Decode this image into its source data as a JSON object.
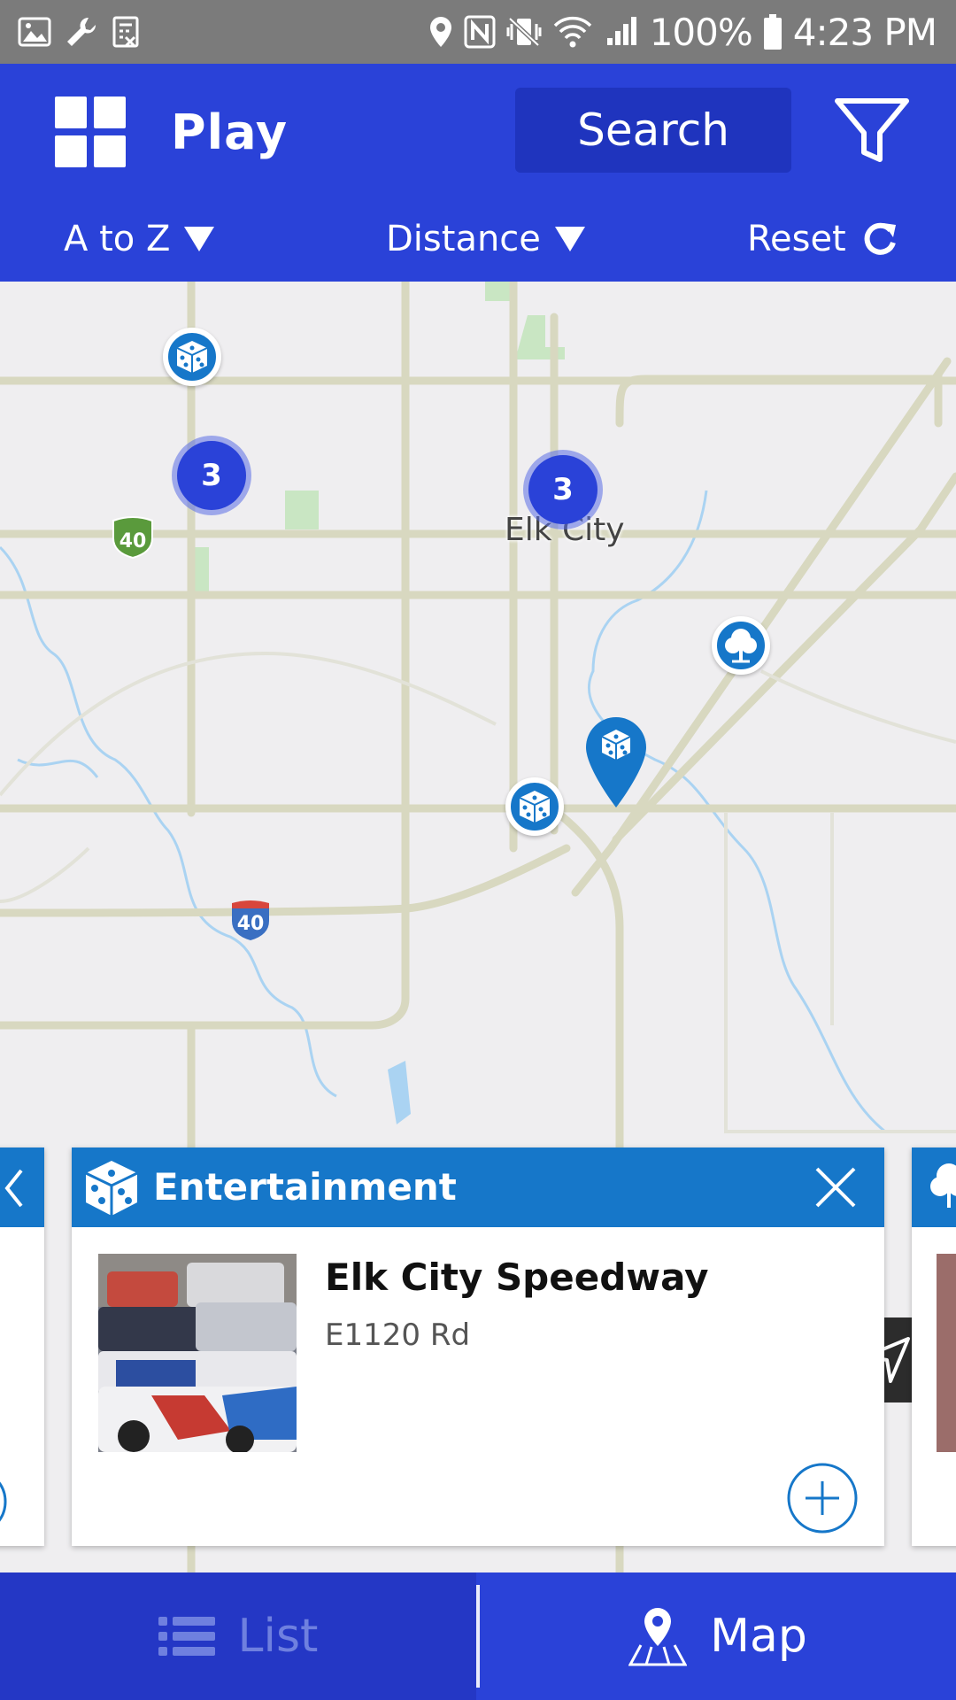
{
  "status_bar": {
    "battery": "100%",
    "time": "4:23 PM",
    "icons": [
      "image-icon",
      "wrench-icon",
      "calculator-icon",
      "location-icon",
      "nfc-icon",
      "vibrate-icon",
      "wifi-icon",
      "signal-icon",
      "battery-icon"
    ]
  },
  "header": {
    "title": "Play",
    "search_label": "Search",
    "icons": [
      "grid-menu-icon",
      "filter-icon"
    ]
  },
  "sort_bar": {
    "sort_label": "A to Z",
    "distance_label": "Distance",
    "reset_label": "Reset"
  },
  "map": {
    "city_label": "Elk City",
    "highway_label_1": "40",
    "highway_label_2": "40",
    "clusters": [
      {
        "count": "3"
      },
      {
        "count": "3"
      }
    ],
    "marker_icons": [
      "dice-icon",
      "tree-icon"
    ],
    "colors": {
      "road": "#d8d8c0",
      "park": "#c9e6c3",
      "water": "#aad3f2",
      "marker": "#1677c9",
      "cluster": "#2a42d8"
    }
  },
  "selected_place": {
    "category": "Entertainment",
    "name": "Elk City Speedway",
    "address": "E1120 Rd"
  },
  "bottom_tabs": {
    "list_label": "List",
    "map_label": "Map"
  },
  "colors": {
    "primary": "#2a42d8",
    "card_header": "#1677c9",
    "status_bar": "#7b7b7b"
  }
}
